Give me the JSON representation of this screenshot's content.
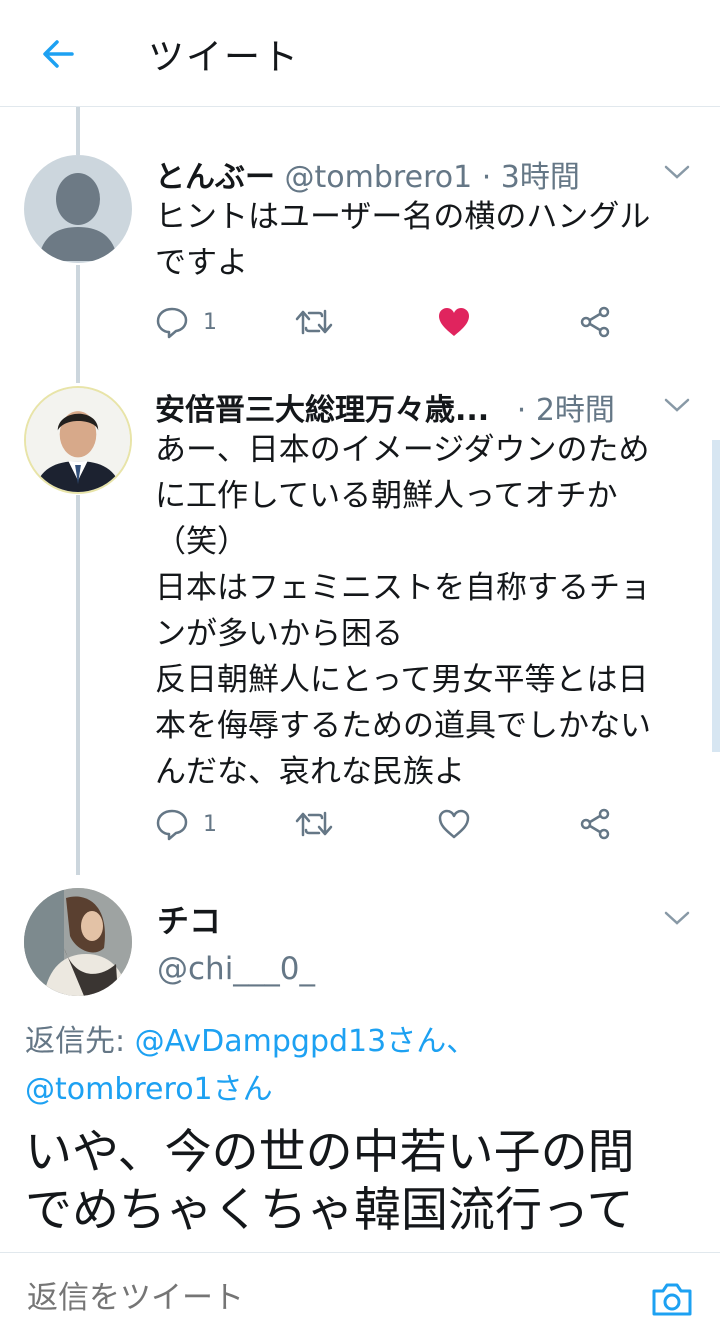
{
  "header": {
    "title": "ツイート",
    "back_icon": "arrow-left-icon"
  },
  "colors": {
    "accent": "#1da1f2",
    "like": "#e0245e",
    "secondary_text": "#657786",
    "thread_line": "#ccd6dd"
  },
  "tweets": [
    {
      "name": "とんぶー",
      "handle": "@tombrero1",
      "time": "· 3時間",
      "text": "ヒントはユーザー名の横のハングル\nですよ",
      "reply_count": "1",
      "liked": true
    },
    {
      "name": "安倍晋三大総理万々歳...",
      "time": "· 2時間",
      "text": "あー、日本のイメージダウンのため\nに工作している朝鮮人ってオチか\n（笑）\n日本はフェミニストを自称するチョ\nンが多いから困る\n反日朝鮮人にとって男女平等とは日\n本を侮辱するための道具でしかない\nんだな、哀れな民族よ",
      "reply_count": "1",
      "liked": false
    }
  ],
  "focused": {
    "name": "チコ",
    "handle": "@chi___0_",
    "reply_prefix": "返信先: ",
    "reply_user1": "@AvDampgpd13さん、",
    "reply_user2": "@tombrero1さん",
    "text": "いや、今の世の中若い子の間\nでめちゃくちゃ韓国流行って"
  },
  "footer": {
    "placeholder": "返信をツイート",
    "camera_icon": "camera-icon"
  }
}
